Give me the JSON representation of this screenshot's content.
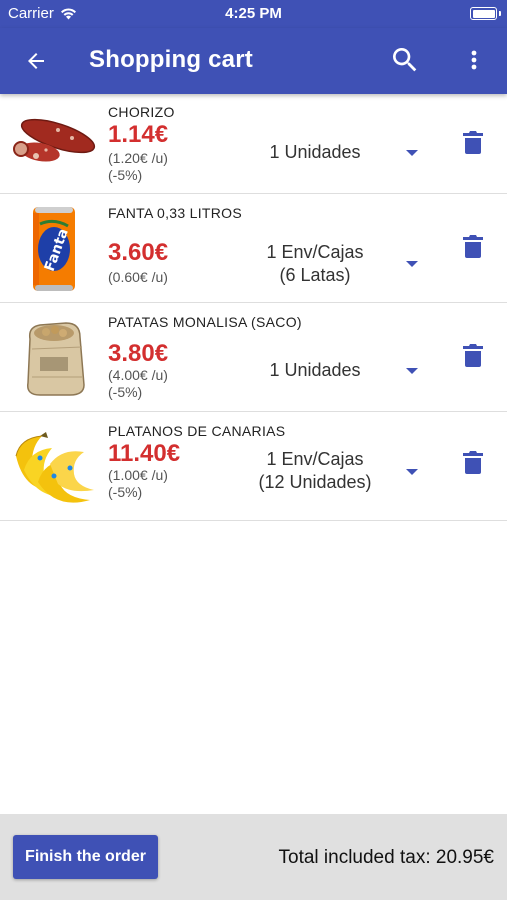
{
  "status_bar": {
    "carrier": "Carrier",
    "time": "4:25 PM"
  },
  "app_bar": {
    "title": "Shopping cart",
    "color": "#3f51b5"
  },
  "items": [
    {
      "name": "CHORIZO",
      "price": "1.14€",
      "unit_price": "(1.20€ /u)",
      "discount": "(-5%)",
      "quantity_line1": "1 Unidades",
      "quantity_line2": "",
      "image": "chorizo-image"
    },
    {
      "name": "FANTA 0,33 LITROS",
      "price": "3.60€",
      "unit_price": "(0.60€ /u)",
      "discount": "",
      "quantity_line1": "1 Env/Cajas",
      "quantity_line2": "(6 Latas)",
      "image": "fanta-can-image"
    },
    {
      "name": "PATATAS MONALISA (SACO)",
      "price": "3.80€",
      "unit_price": "(4.00€ /u)",
      "discount": "(-5%)",
      "quantity_line1": "1 Unidades",
      "quantity_line2": "",
      "image": "potato-sack-image"
    },
    {
      "name": "PLATANOS DE CANARIAS",
      "price": "11.40€",
      "unit_price": "(1.00€ /u)",
      "discount": "(-5%)",
      "quantity_line1": "1 Env/Cajas",
      "quantity_line2": "(12 Unidades)",
      "image": "bananas-image"
    }
  ],
  "footer": {
    "finish_label": "Finish the order",
    "total_text": "Total included tax: 20.95€"
  },
  "colors": {
    "primary": "#3f51b5",
    "price": "#d32f2f",
    "footer_bg": "#e0e0e0"
  }
}
